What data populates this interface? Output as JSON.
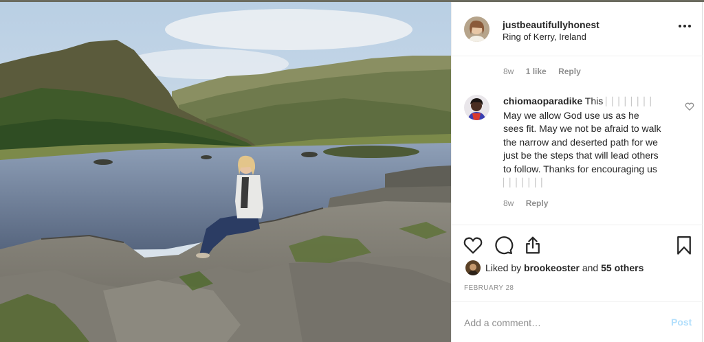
{
  "post": {
    "username": "justbeautifullyhonest",
    "location": "Ring of Kerry, Ireland"
  },
  "caption_meta": {
    "time": "8w",
    "likes": "1 like",
    "reply": "Reply"
  },
  "comments": [
    {
      "username": "chiomaoparadike",
      "text_start": "This",
      "emoji_placeholder": "▏▏▏▏▏▏▏▏",
      "text_body": "May we allow God use us as he sees fit. May we not be afraid to walk the narrow and deserted path for we just be the steps that will lead others to follow. Thanks for encouraging us",
      "emoji_end": "▏▏▏▏▏▏▏",
      "time": "8w",
      "reply": "Reply"
    }
  ],
  "likes": {
    "prefix": "Liked by",
    "user": "brookeoster",
    "joiner": "and",
    "others": "55 others"
  },
  "date": "FEBRUARY 28",
  "add_comment": {
    "placeholder": "Add a comment…",
    "post_label": "Post"
  },
  "icons": {
    "like": "heart-icon",
    "comment": "comment-bubble-icon",
    "share": "share-icon",
    "save": "bookmark-icon",
    "more": "more-options-icon",
    "comment_like": "small-heart-icon"
  },
  "colors": {
    "text": "#262626",
    "muted": "#8e8e8e",
    "post_disabled": "#b2dffc",
    "divider": "#efefef"
  }
}
